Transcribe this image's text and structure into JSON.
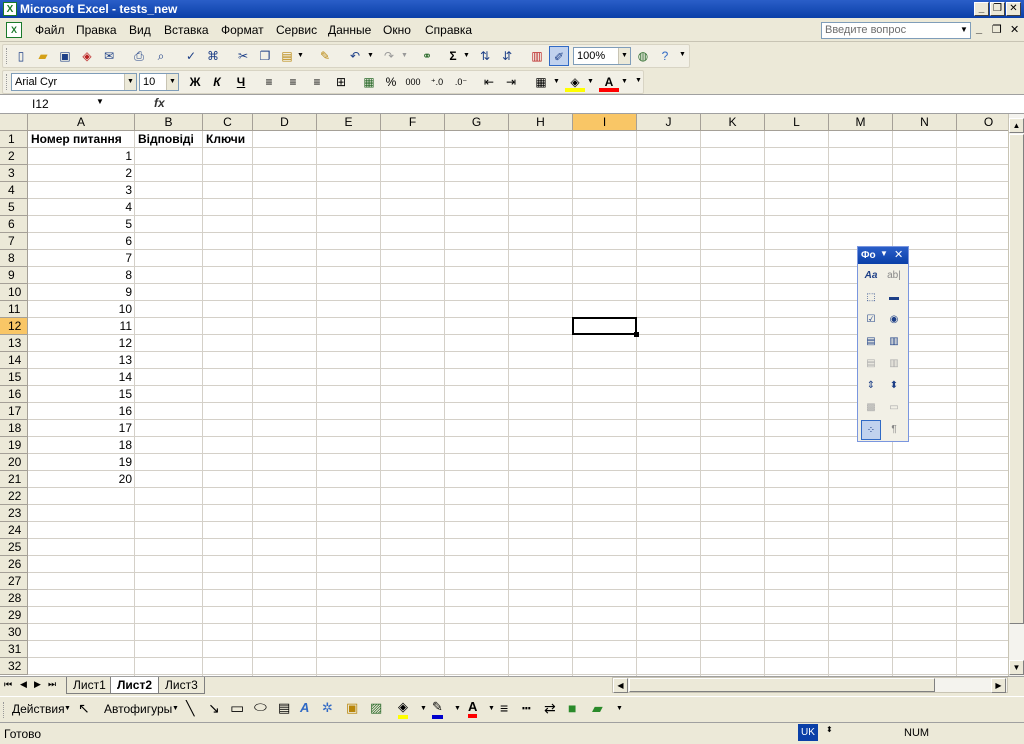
{
  "title": "Microsoft Excel - tests_new",
  "menu": [
    "Файл",
    "Правка",
    "Вид",
    "Вставка",
    "Формат",
    "Сервис",
    "Данные",
    "Окно",
    "Справка"
  ],
  "menu_accel": [
    "Ф",
    "П",
    "В",
    "В",
    "Ф",
    "С",
    "Д",
    "О",
    "С"
  ],
  "ask_placeholder": "Введите вопрос",
  "toolbar": {
    "zoom": "100%",
    "font_name": "Arial Cyr",
    "font_size": "10",
    "bold": "Ж",
    "italic": "К",
    "underline": "Ч",
    "sigma": "Σ",
    "percent": "%",
    "thousands": "000"
  },
  "formula": {
    "name_box": "I12",
    "fx": "fx",
    "value": ""
  },
  "columns": [
    "A",
    "B",
    "C",
    "D",
    "E",
    "F",
    "G",
    "H",
    "I",
    "J",
    "K",
    "L",
    "M",
    "N",
    "O"
  ],
  "rows": [
    "1",
    "2",
    "3",
    "4",
    "5",
    "6",
    "7",
    "8",
    "9",
    "10",
    "11",
    "12",
    "13",
    "14",
    "15",
    "16",
    "17",
    "18",
    "19",
    "20",
    "21",
    "22",
    "23",
    "24",
    "25",
    "26",
    "27",
    "28",
    "29",
    "30",
    "31",
    "32"
  ],
  "cells": {
    "A1": "Номер питання",
    "B1": "Відповіді",
    "C1": "Ключи",
    "A_values": [
      "1",
      "2",
      "3",
      "4",
      "5",
      "6",
      "7",
      "8",
      "9",
      "10",
      "11",
      "12",
      "13",
      "14",
      "15",
      "16",
      "17",
      "18",
      "19",
      "20"
    ]
  },
  "selected_cell": "I12",
  "sheets": [
    "Лист1",
    "Лист2",
    "Лист3"
  ],
  "active_sheet": "Лист2",
  "draw": {
    "actions": "Действия",
    "autoshapes": "Автофигуры"
  },
  "palette_title": "Фо",
  "status": {
    "ready": "Готово",
    "lang": "UK",
    "num": "NUM"
  }
}
